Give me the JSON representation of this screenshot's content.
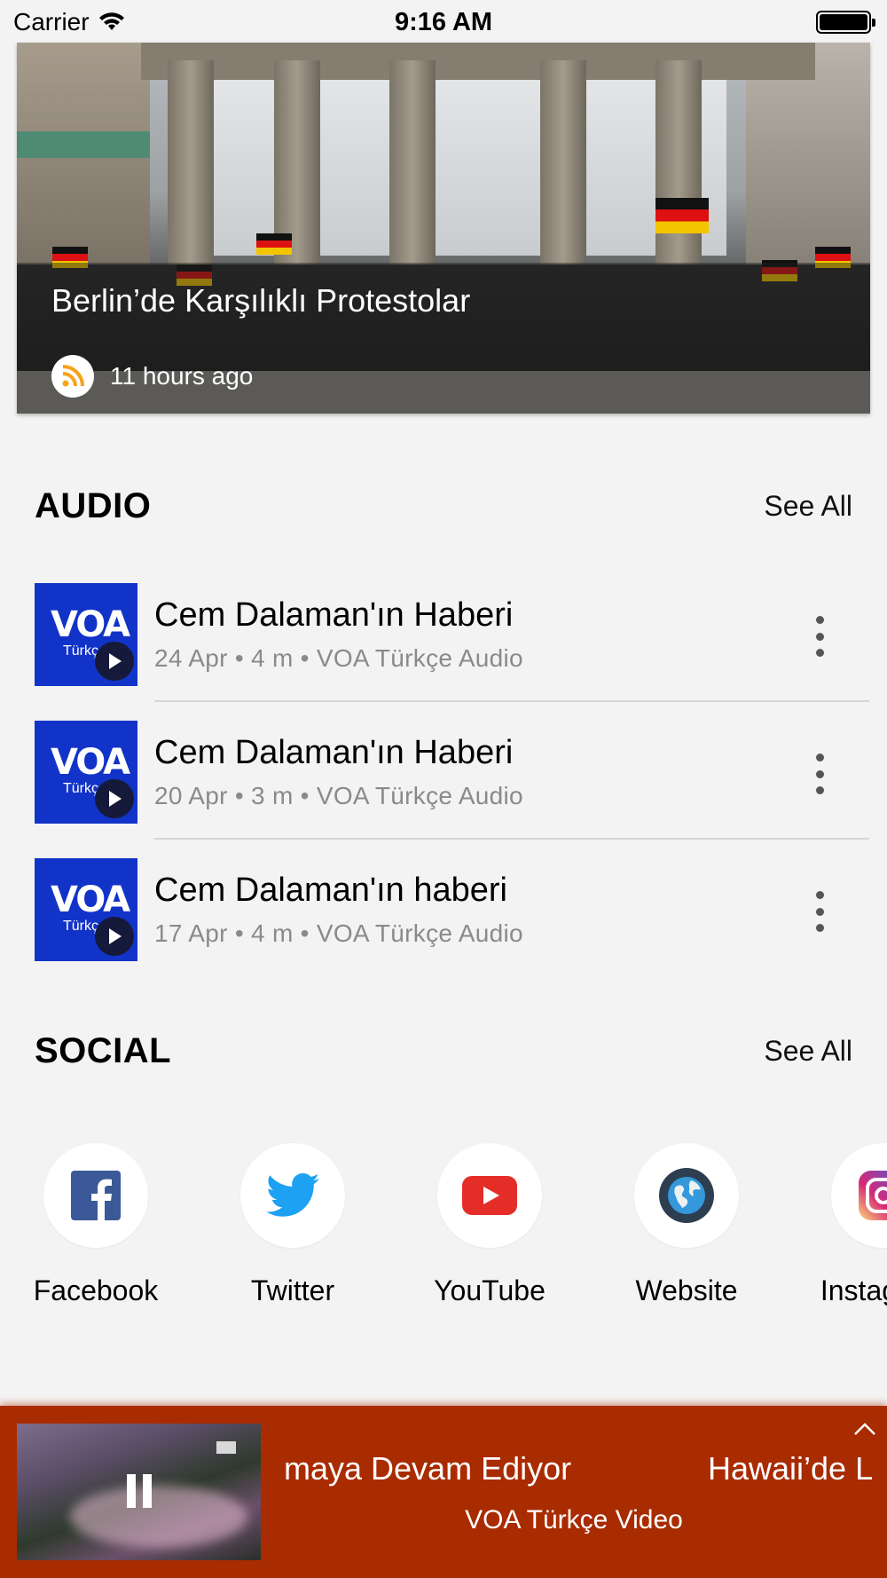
{
  "status_bar": {
    "carrier": "Carrier",
    "time": "9:16 AM"
  },
  "hero": {
    "title": "Berlin’de Karşılıklı Protestolar",
    "time": "11 hours ago",
    "icon": "rss-icon"
  },
  "audio": {
    "title": "AUDIO",
    "see_all": "See All",
    "items": [
      {
        "title": "Cem Dalaman'ın Haberi",
        "meta": "24 Apr • 4 m • VOA Türkçe Audio",
        "logo": "VOA",
        "logo_sub": "Türkçe"
      },
      {
        "title": "Cem Dalaman'ın Haberi",
        "meta": "20 Apr • 3 m • VOA Türkçe Audio",
        "logo": "VOA",
        "logo_sub": "Türkçe"
      },
      {
        "title": "Cem Dalaman'ın haberi",
        "meta": "17 Apr • 4 m • VOA Türkçe Audio",
        "logo": "VOA",
        "logo_sub": "Türkçe"
      }
    ]
  },
  "social": {
    "title": "SOCIAL",
    "see_all": "See All",
    "items": [
      {
        "label": "Facebook",
        "icon": "facebook-icon"
      },
      {
        "label": "Twitter",
        "icon": "twitter-icon"
      },
      {
        "label": "YouTube",
        "icon": "youtube-icon"
      },
      {
        "label": "Website",
        "icon": "globe-icon"
      },
      {
        "label": "Instagram",
        "icon": "instagram-icon"
      }
    ]
  },
  "mini_player": {
    "title_visible": "maya Devam Ediyor",
    "next_title_visible": "Hawaii’de L",
    "subtitle": "VOA Türkçe Video",
    "state": "playing"
  },
  "colors": {
    "background": "#f3f3f3",
    "player": "#a92b00",
    "voa_blue": "#1233c8",
    "rss": "#f7a21b"
  }
}
